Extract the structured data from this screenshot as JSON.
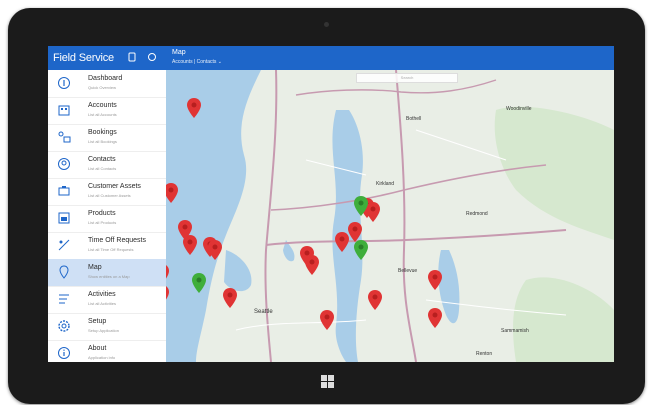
{
  "app": {
    "title": "Field Service",
    "view_title": "Map",
    "view_subtitle": "Accounts | Contacts ⌄"
  },
  "map": {
    "search_placeholder": "Search",
    "labels": [
      "Seattle",
      "Bellevue",
      "Redmond",
      "Kirkland",
      "Sammamish",
      "Bothell",
      "Woodinville",
      "Renton"
    ]
  },
  "nav": [
    {
      "label": "Dashboard",
      "sub": "Quick Overview",
      "icon": "dashboard-icon"
    },
    {
      "label": "Accounts",
      "sub": "List all Accounts",
      "icon": "accounts-icon"
    },
    {
      "label": "Bookings",
      "sub": "List all Bookings",
      "icon": "bookings-icon"
    },
    {
      "label": "Contacts",
      "sub": "List all Contacts",
      "icon": "contacts-icon"
    },
    {
      "label": "Customer Assets",
      "sub": "List all Customer Assets",
      "icon": "assets-icon"
    },
    {
      "label": "Products",
      "sub": "List all Products",
      "icon": "products-icon"
    },
    {
      "label": "Time Off Requests",
      "sub": "List all Time Off Requests",
      "icon": "time-off-icon"
    },
    {
      "label": "Map",
      "sub": "Show entities on a Map",
      "icon": "map-icon"
    },
    {
      "label": "Activities",
      "sub": "List all Activities",
      "icon": "activities-icon"
    },
    {
      "label": "Setup",
      "sub": "Setup Application",
      "icon": "setup-icon"
    },
    {
      "label": "About",
      "sub": "Application info",
      "icon": "about-icon"
    }
  ],
  "colors": {
    "appbar": "#1e66c9",
    "pin_red": "#e03434",
    "pin_green": "#3fae3b",
    "water": "#a9cde8",
    "active_nav": "#cfe0f5"
  }
}
